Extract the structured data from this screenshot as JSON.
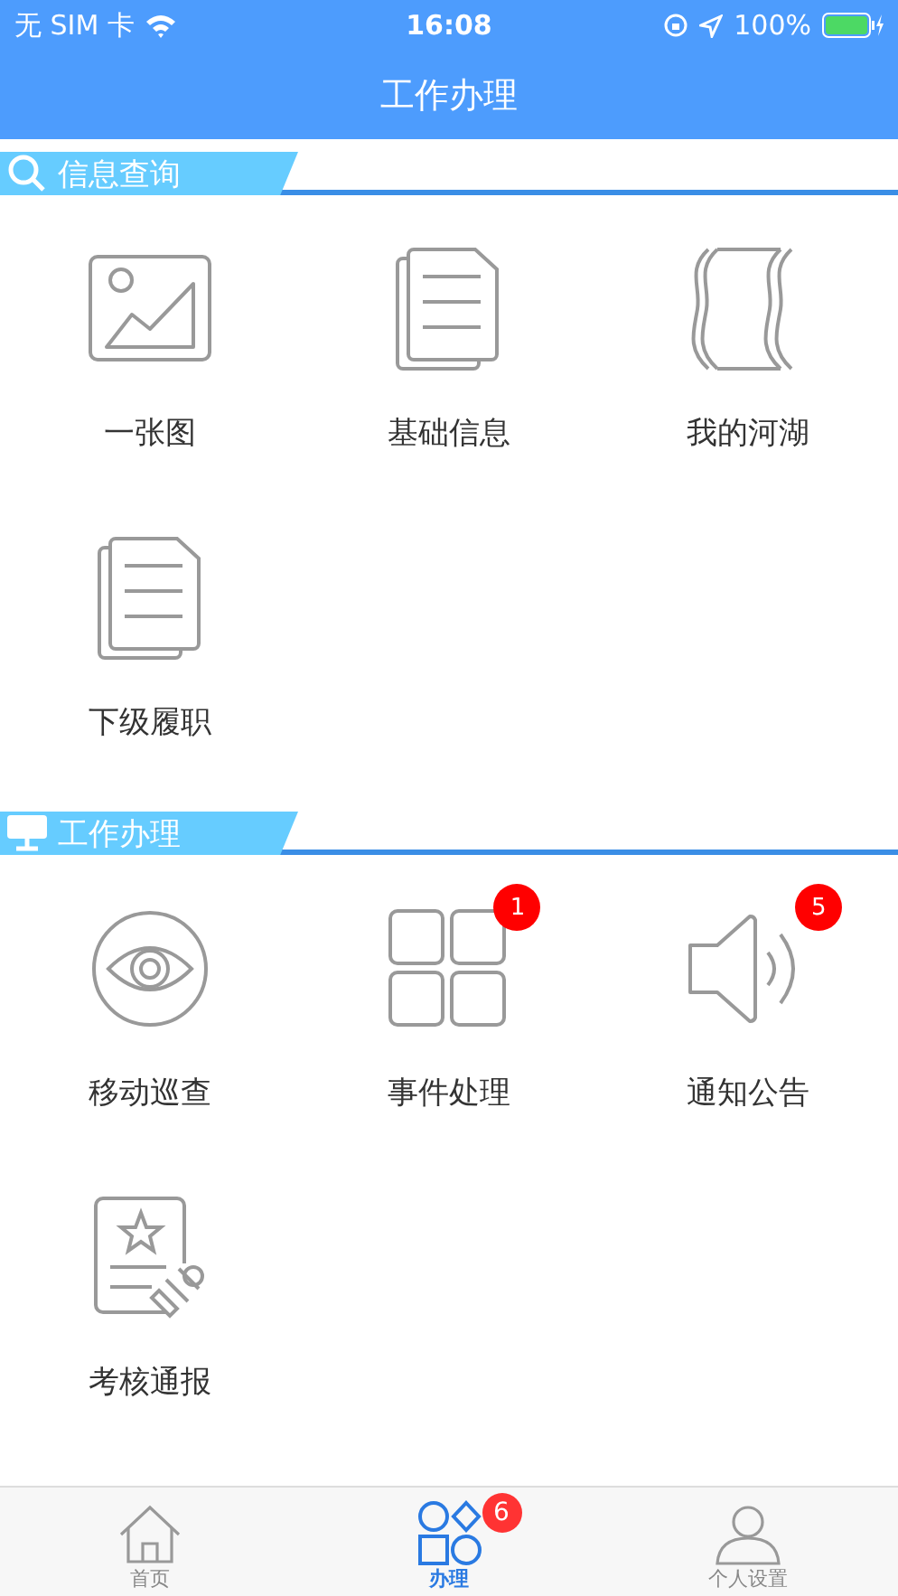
{
  "status_bar": {
    "carrier": "无 SIM 卡",
    "time": "16:08",
    "battery": "100%"
  },
  "nav": {
    "title": "工作办理"
  },
  "sections": [
    {
      "title": "信息查询",
      "kind": "search",
      "items": [
        {
          "label": "一张图",
          "kind": "picture"
        },
        {
          "label": "基础信息",
          "kind": "documents"
        },
        {
          "label": "我的河湖",
          "kind": "river"
        },
        {
          "label": "下级履职",
          "kind": "documents"
        }
      ]
    },
    {
      "title": "工作办理",
      "kind": "monitor",
      "items": [
        {
          "label": "移动巡查",
          "kind": "eye"
        },
        {
          "label": "事件处理",
          "kind": "grid",
          "badge": "1"
        },
        {
          "label": "通知公告",
          "kind": "speaker",
          "badge": "5"
        },
        {
          "label": "考核通报",
          "kind": "certificate"
        }
      ]
    }
  ],
  "tab_bar": [
    {
      "label": "首页",
      "kind": "home",
      "selected": false
    },
    {
      "label": "办理",
      "kind": "shapes",
      "selected": true,
      "badge": "6"
    },
    {
      "label": "个人设置",
      "kind": "person",
      "selected": false
    }
  ]
}
